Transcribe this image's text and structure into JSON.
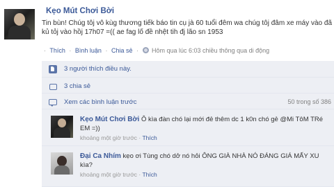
{
  "post": {
    "author": "Kẹo Mút Chơi Bời",
    "text": "Tin bùn! Chúg tôj vô kùg thương tiếk báo tin cụ jà 60 tuổi đêm wa chúg tôj đâm xe máy vào đã kủ tỏj vào hồj 17h07 =(( ae fag lố đề nhệt tih đj lão sn 1953",
    "actions": {
      "like": "Thích",
      "comment": "Bình luận",
      "share": "Chia sẻ",
      "timestamp": "Hôm qua lúc 6:03 chiều thông qua di động",
      "separator": "·"
    },
    "likes": "3 người thích điều này.",
    "shares": "3 chia sẻ",
    "view_previous": "Xem các bình luận trước",
    "comment_count": "50 trong số 386"
  },
  "comments": [
    {
      "author": "Kẹo Mút Chơi Bời",
      "text": "Ô kìa đàn chó lại mới đẻ thêm dc 1 k0n chó gẻ @Mi TôM TRé EM =))",
      "time": "khoảng một giờ trước",
      "like": "Thích"
    },
    {
      "author": "Đại Ca Nhím",
      "text": "kẹo ơi Tùng chó dở nó hỏi ÔNG GIÀ NHÀ NÓ ĐÁNG GIÁ MẤY XU kìa?",
      "time": "khoảng một giờ trước",
      "like": "Thích"
    }
  ],
  "icons": {
    "avatar": "profile-photo",
    "globe": "globe-icon",
    "like": "thumbs-up-icon",
    "share": "share-icon",
    "comment": "comment-bubble-icon"
  },
  "colors": {
    "link": "#3b5998",
    "ufi_background": "#edeff4",
    "meta_text": "#808080"
  }
}
